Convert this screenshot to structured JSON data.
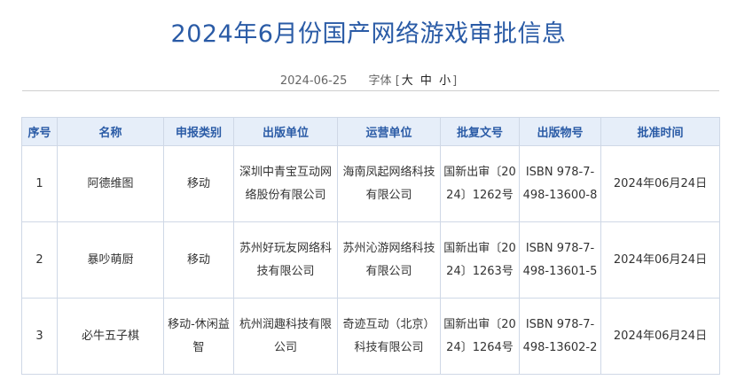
{
  "title": "2024年6月份国产网络游戏审批信息",
  "meta": {
    "date": "2024-06-25",
    "font_label": "字体",
    "bracket_open": "[",
    "size_large": "大",
    "size_medium": "中",
    "size_small": "小",
    "bracket_close": "]"
  },
  "table": {
    "headers": [
      "序号",
      "名称",
      "申报类别",
      "出版单位",
      "运营单位",
      "批复文号",
      "出版物号",
      "批准时间"
    ],
    "rows": [
      [
        "1",
        "阿德维图",
        "移动",
        "深圳中青宝互动网络股份有限公司",
        "海南凤起网络科技有限公司",
        "国新出审〔2024〕1262号",
        "ISBN 978-7-498-13600-8",
        "2024年06月24日"
      ],
      [
        "2",
        "暴吵萌厨",
        "移动",
        "苏州好玩友网络科技有限公司",
        "苏州沁游网络科技有限公司",
        "国新出审〔2024〕1263号",
        "ISBN 978-7-498-13601-5",
        "2024年06月24日"
      ],
      [
        "3",
        "必牛五子棋",
        "移动-休闲益智",
        "杭州润趣科技有限公司",
        "奇迹互动（北京）科技有限公司",
        "国新出审〔2024〕1264号",
        "ISBN 978-7-498-13602-2",
        "2024年06月24日"
      ]
    ]
  }
}
